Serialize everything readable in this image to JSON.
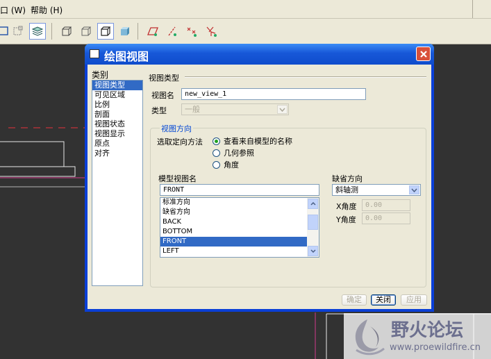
{
  "menubar": {
    "window_menu": "口 (W)",
    "help_menu": "帮助 (H)"
  },
  "dialog": {
    "title": "绘图视图",
    "categories_label": "类别",
    "categories": [
      "视图类型",
      "可见区域",
      "比例",
      "剖面",
      "视图状态",
      "视图显示",
      "原点",
      "对齐"
    ],
    "selected_category": 0,
    "view_type_section": "视图类型",
    "view_name_label": "视图名",
    "view_name_value": "new_view_1",
    "type_label": "类型",
    "type_value": "一般",
    "orientation_group": "视图方向",
    "orient_method_label": "选取定向方法",
    "orient_options": [
      "查看来自模型的名称",
      "几何参照",
      "角度"
    ],
    "selected_orient": 0,
    "model_view_name_label": "模型视图名",
    "model_view_name_value": "FRONT",
    "model_views": [
      "标准方向",
      "缺省方向",
      "BACK",
      "BOTTOM",
      "FRONT",
      "LEFT"
    ],
    "selected_model_view": 4,
    "default_orient_label": "缺省方向",
    "default_orient_value": "斜轴测",
    "x_angle_label": "X角度",
    "x_angle_value": "0.00",
    "y_angle_label": "Y角度",
    "y_angle_value": "0.00",
    "buttons": {
      "ok": "确定",
      "close": "关闭",
      "apply": "应用"
    }
  },
  "watermark": {
    "brand": "野火论坛",
    "url": "www.proewildfire.cn"
  },
  "colors": {
    "accent": "#0a3fd6",
    "selection": "#316ac5",
    "canvas": "#323232",
    "redline": "#e8323c"
  }
}
